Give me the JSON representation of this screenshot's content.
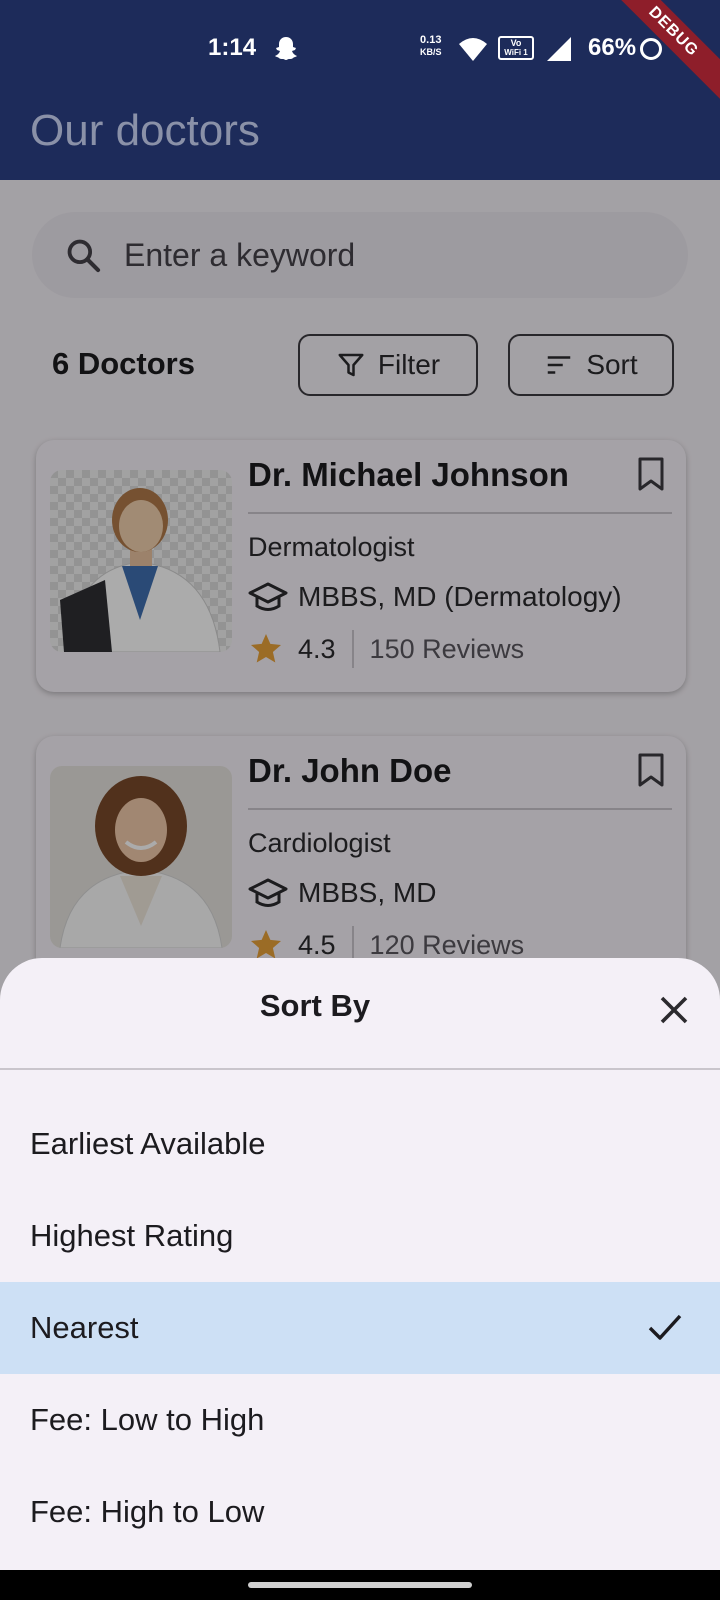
{
  "status_bar": {
    "time": "1:14",
    "net_speed_value": "0.13",
    "net_speed_unit": "KB/S",
    "vowifi_line1": "Vo",
    "vowifi_line2": "WiFi 1",
    "battery": "66%",
    "icons": [
      "snapchat-icon",
      "wifi-icon",
      "vowifi-icon",
      "signal-icon",
      "battery-icon"
    ]
  },
  "debug_banner": "DEBUG",
  "app_bar": {
    "title": "Our doctors"
  },
  "search": {
    "placeholder": "Enter a keyword",
    "value": ""
  },
  "results": {
    "count_label": "6 Doctors",
    "filter_label": "Filter",
    "sort_label": "Sort"
  },
  "doctors": [
    {
      "name": "Dr. Michael Johnson",
      "specialty": "Dermatologist",
      "degree": "MBBS, MD (Dermatology)",
      "rating": "4.3",
      "reviews": "150 Reviews"
    },
    {
      "name": "Dr. John Doe",
      "specialty": "Cardiologist",
      "degree": "MBBS, MD",
      "rating": "4.5",
      "reviews": "120 Reviews"
    }
  ],
  "sort_sheet": {
    "title": "Sort By",
    "options": [
      {
        "label": "Earliest Available",
        "selected": false
      },
      {
        "label": "Highest Rating",
        "selected": false
      },
      {
        "label": "Nearest",
        "selected": true
      },
      {
        "label": "Fee: Low to High",
        "selected": false
      },
      {
        "label": "Fee: High to Low",
        "selected": false
      }
    ]
  },
  "colors": {
    "app_bar": "#1d2b5a",
    "selected_option": "#cde0f5",
    "star": "#e8a13a",
    "debug_ribbon": "#8e1e2a"
  }
}
